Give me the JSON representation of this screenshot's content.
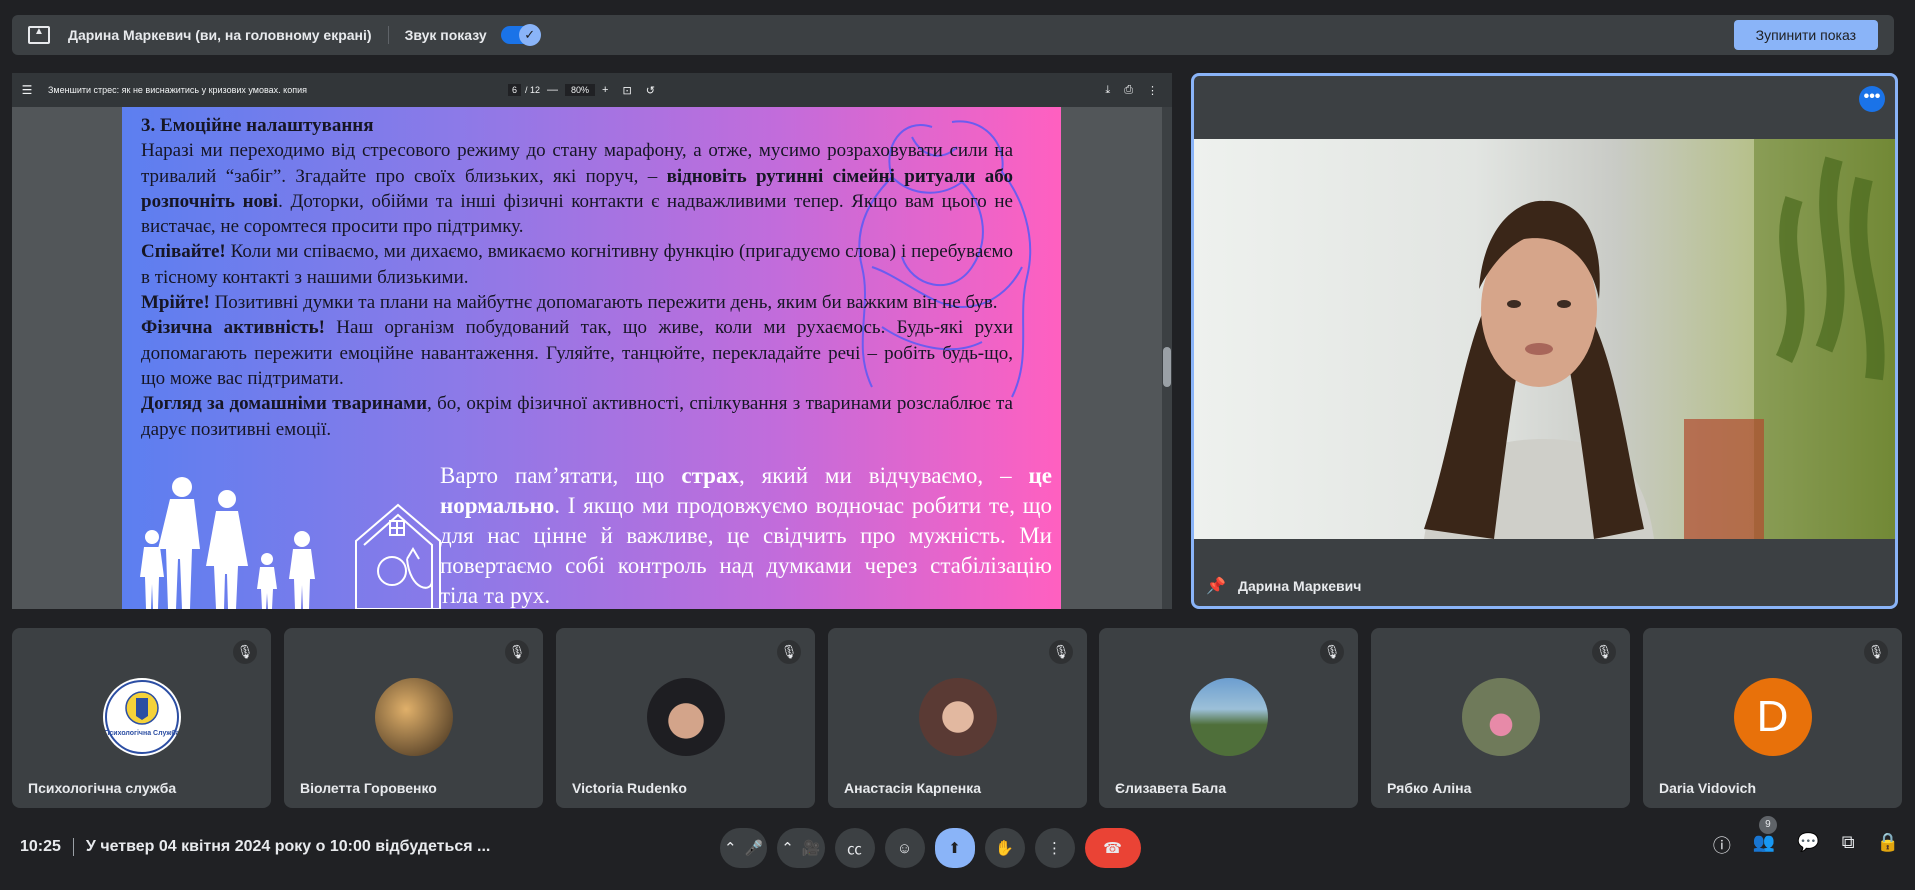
{
  "present_bar": {
    "presenter": "Дарина Маркевич (ви, на головному екрані)",
    "sound_label": "Звук показу",
    "sound_on": true,
    "stop_button": "Зупинити показ"
  },
  "pdf": {
    "title": "Зменшити стрес: як не виснажитись у кризових умовах. копия",
    "page_current": "6",
    "page_total": "/ 12",
    "zoom": "80%",
    "zoom_out": "—",
    "zoom_in": "+",
    "content": {
      "heading": "3. Емоційне налаштування",
      "p1a": "Наразі ми переходимо від стресового режиму до стану марафону, а отже, мусимо розраховувати сили на тривалий “забіг”. Згадайте про своїх близьких, які поруч, –",
      "p1b": "відновіть рутинні сімейні ритуали або розпочніть нові",
      "p1c": ". Доторки, обійми та інші фізичні контакти є надважливими тепер. Якщо вам цього не вистачає, не соромтеся просити про підтримку.",
      "p2a": "Співайте!",
      "p2b": " Коли ми співаємо, ми дихаємо, вмикаємо когнітивну функцію (пригадуємо слова) і перебуваємо в тісному контакті з нашими близькими.",
      "p3a": "Мрійте!",
      "p3b": " Позитивні думки та плани на майбутнє допомагають пережити день, яким би важким він не був.",
      "p4a": "Фізична активність!",
      "p4b": " Наш організм побудований так, що живе, коли ми рухаємось. Будь-які рухи допомагають пережити емоційне навантаження. Гуляйте, танцюйте, перекладайте речі – робіть будь-що, що може вас підтримати.",
      "p5a": "Догляд за домашніми тваринами",
      "p5b": ", бо, окрім фізичної активності, спілкування з тваринами розслаблює та дарує позитивні емоції.",
      "big1": "Варто пам’ятати, що ",
      "big2": "страх",
      "big3": ", який ми відчуваємо, – ",
      "big4": "це нормально",
      "big5": ". І якщо ми продовжуємо водночас робити те, що для нас цінне й важливе, це свідчить про мужність. Ми повертаємо собі контроль над думками через стабілізацію тіла та рух."
    }
  },
  "speaker": {
    "name": "Дарина Маркевич"
  },
  "participants": [
    {
      "name": "Психологічна служба",
      "avatar": "logo",
      "logo_text": "Психологічна Служба",
      "muted": true
    },
    {
      "name": "Віолетта Горовенко",
      "avatar": "photo",
      "color": "#6b4e2e",
      "muted": true
    },
    {
      "name": "Victoria Rudenko",
      "avatar": "photo",
      "color": "#2a2a30",
      "muted": true
    },
    {
      "name": "Анастасія Карпенка",
      "avatar": "photo",
      "color": "#5a3a34",
      "muted": true
    },
    {
      "name": "Єлизавета Бала",
      "avatar": "photo",
      "color": "#4f6f3a",
      "muted": true
    },
    {
      "name": "Рябко Аліна",
      "avatar": "photo",
      "color": "#6f7a5a",
      "muted": true
    },
    {
      "name": "Daria Vidovich",
      "avatar": "initial",
      "initial": "D",
      "color": "#e8710a",
      "muted": true
    }
  ],
  "bottom": {
    "time": "10:25",
    "meeting": "У четвер 04 квітня 2024 року о 10:00 відбудеться ...",
    "people_count": "9"
  },
  "icons": [
    "share-screen-icon",
    "chevron-up-icon",
    "mic-icon",
    "camera-icon",
    "captions-icon",
    "emoji-icon",
    "present-icon",
    "hand-icon",
    "more-icon",
    "end-call-icon",
    "info-icon",
    "people-icon",
    "chat-icon",
    "activities-icon",
    "lock-icon",
    "pin-icon",
    "mic-off-icon"
  ]
}
